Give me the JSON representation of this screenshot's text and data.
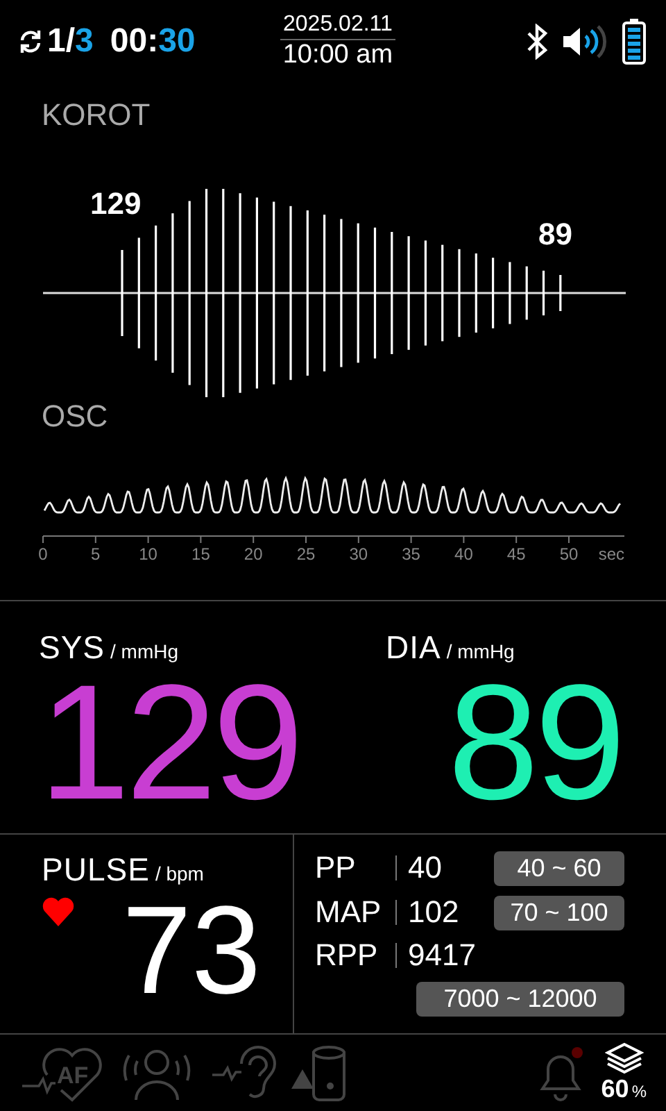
{
  "status_bar": {
    "cycle_current": "1",
    "cycle_separator": "/",
    "cycle_total": "3",
    "timer_minutes": "00",
    "timer_colon": ":",
    "timer_seconds": "30",
    "date": "2025.02.11",
    "time": "10:00 am"
  },
  "korotkoff": {
    "title": "KOROT",
    "sys_marker": "129",
    "dia_marker": "89"
  },
  "oscillometric": {
    "title": "OSC",
    "ticks": [
      "0",
      "5",
      "10",
      "15",
      "20",
      "25",
      "30",
      "35",
      "40",
      "45",
      "50"
    ],
    "unit": "sec"
  },
  "sys": {
    "label": "SYS",
    "unit": "/ mmHg",
    "value": "129",
    "color": "#c83ed2"
  },
  "dia": {
    "label": "DIA",
    "unit": "/ mmHg",
    "value": "89",
    "color": "#1eefb2"
  },
  "pulse": {
    "label": "PULSE",
    "unit": "/ bpm",
    "value": "73"
  },
  "indices": [
    {
      "label": "PP",
      "value": "40",
      "range": "40 ~ 60"
    },
    {
      "label": "MAP",
      "value": "102",
      "range": "70 ~ 100"
    },
    {
      "label": "RPP",
      "value": "9417",
      "range": "7000 ~ 12000"
    }
  ],
  "bottom_bar": {
    "af_label": "AF",
    "memory_value": "60",
    "memory_unit": "%"
  }
}
